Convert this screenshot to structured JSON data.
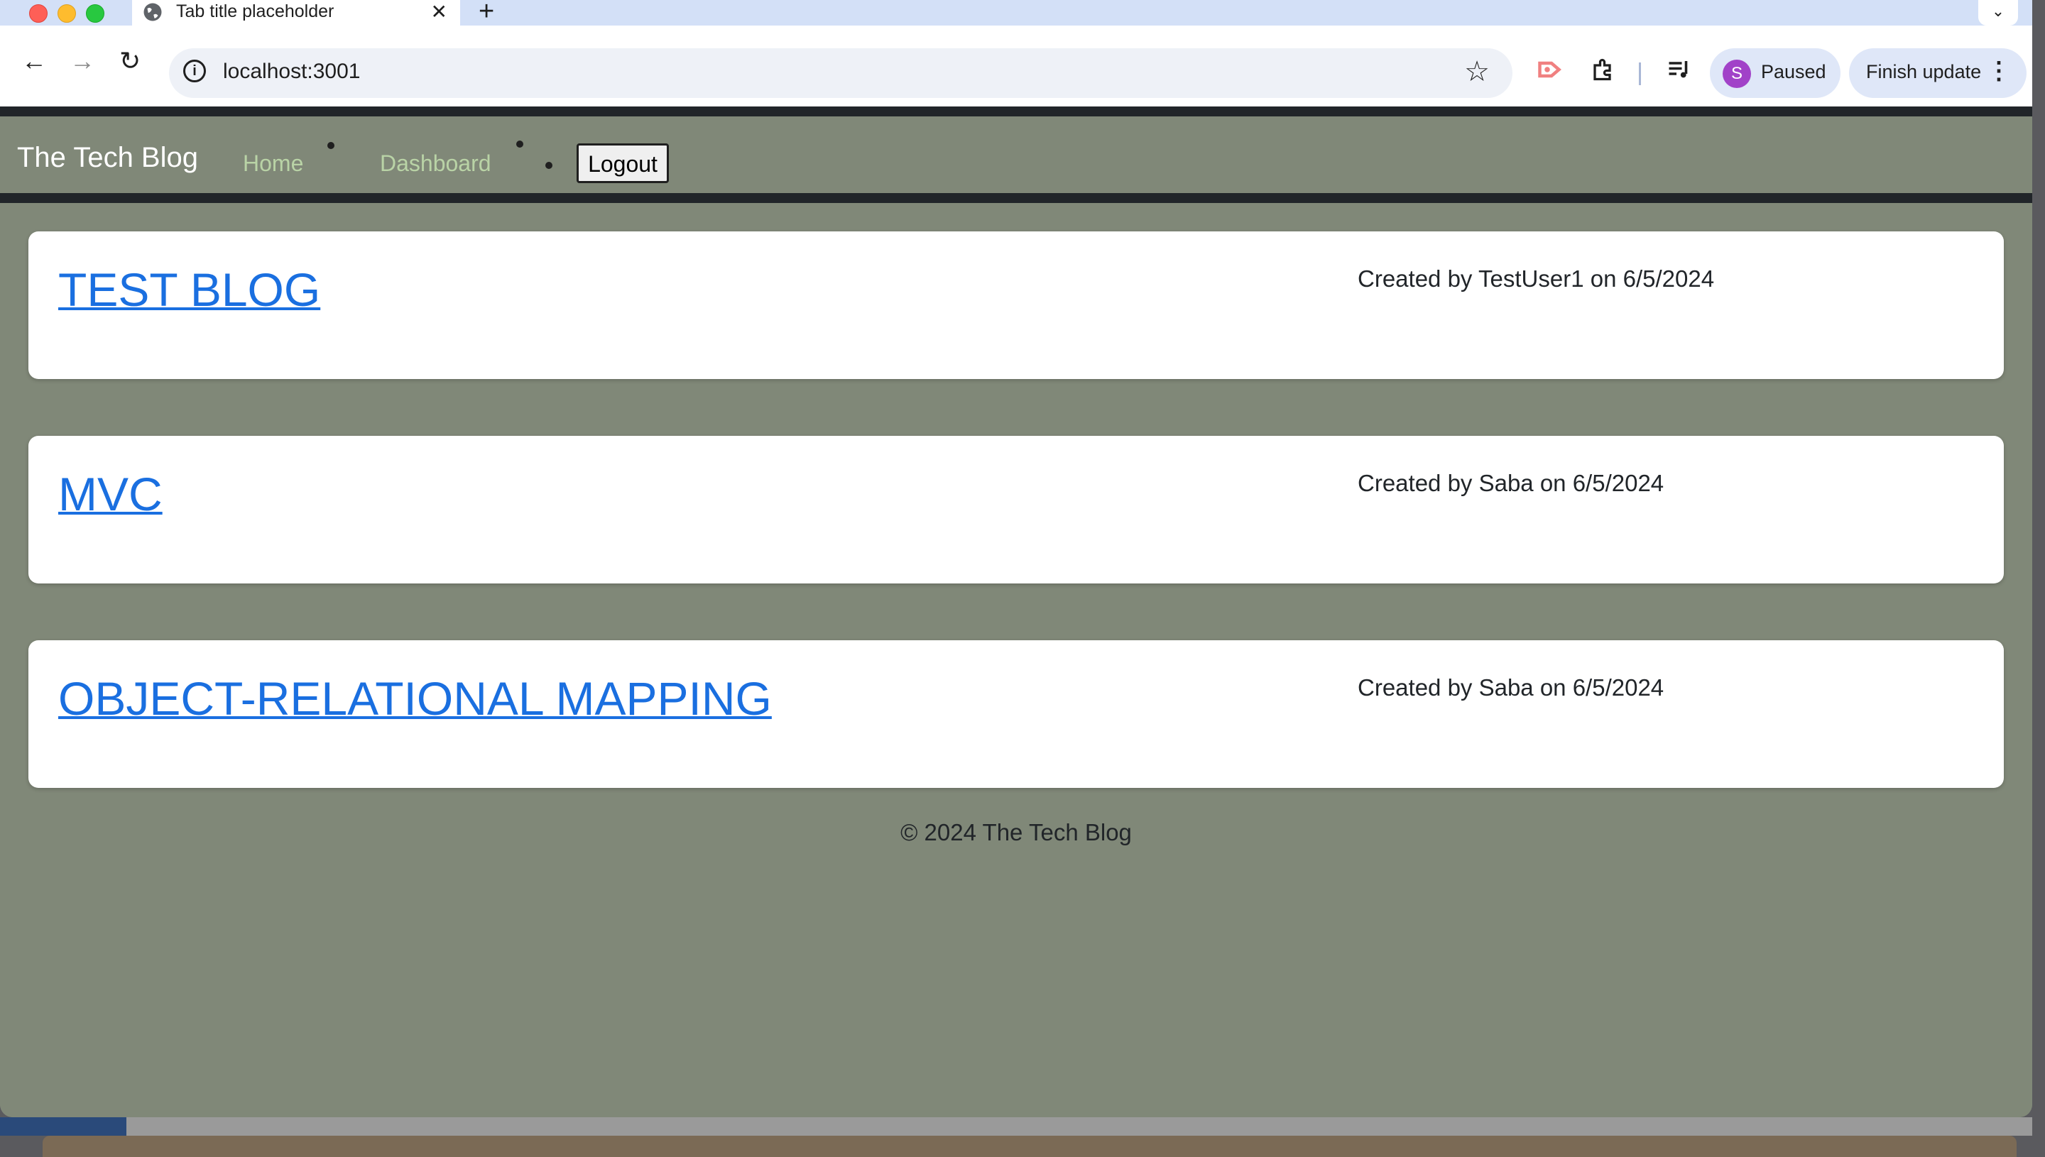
{
  "browser": {
    "tab_title": "Tab title placeholder",
    "url": "localhost:3001",
    "profile_initial": "S",
    "profile_status": "Paused",
    "update_label": "Finish update"
  },
  "nav": {
    "brand": "The Tech Blog",
    "links": [
      "Home",
      "Dashboard"
    ],
    "logout_label": "Logout"
  },
  "posts": [
    {
      "title": "TEST BLOG",
      "meta": "Created by TestUser1 on 6/5/2024"
    },
    {
      "title": "MVC",
      "meta": "Created by Saba on 6/5/2024"
    },
    {
      "title": "OBJECT-RELATIONAL MAPPING",
      "meta": "Created by Saba on 6/5/2024"
    }
  ],
  "footer": "© 2024 The Tech Blog",
  "colors": {
    "link": "#1a6fe0",
    "page_bg": "#808878",
    "nav_link": "#b9d3a6",
    "navbar_border": "#212529"
  }
}
